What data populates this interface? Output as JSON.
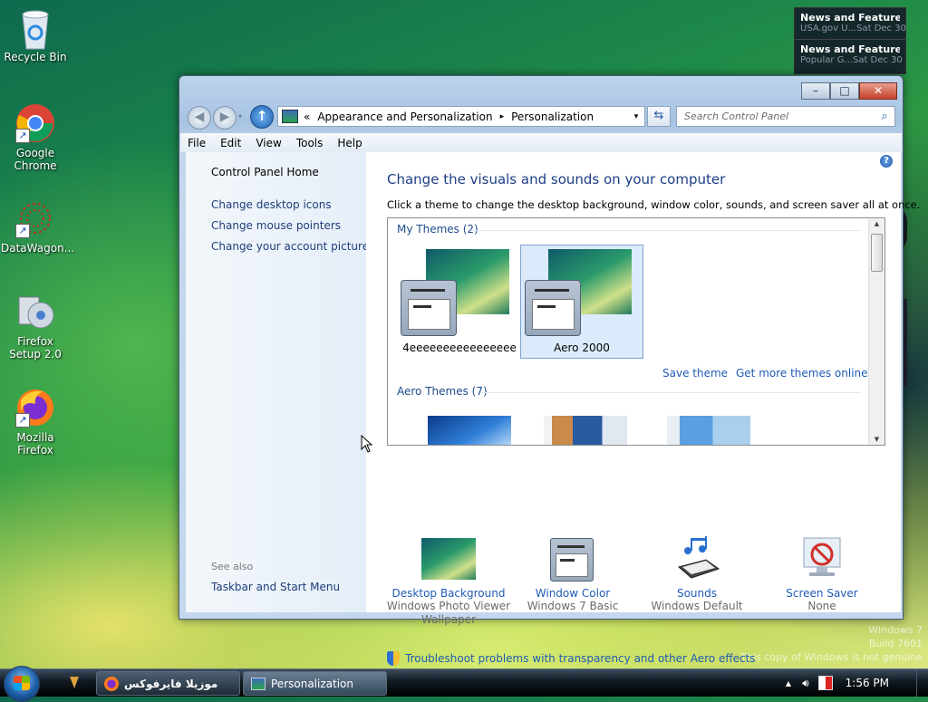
{
  "desktop": {
    "icons": [
      {
        "label": "Recycle Bin",
        "icon": "recycle-bin-icon"
      },
      {
        "label": "Google Chrome",
        "icon": "chrome-icon"
      },
      {
        "label": "DataWagon...",
        "icon": "datawagon-icon"
      },
      {
        "label": "Firefox Setup 2.0",
        "icon": "installer-icon"
      },
      {
        "label": "Mozilla Firefox",
        "icon": "firefox-icon"
      }
    ],
    "gadget": [
      {
        "title": "News and Features f...",
        "source": "USA.gov U...",
        "date": "Sat Dec 30"
      },
      {
        "title": "News and Feature...",
        "source": "Popular G...",
        "date": "Sat Dec 30"
      }
    ],
    "watermark": [
      "Windows 7",
      "Build 7601",
      "This copy of Windows is not genuine"
    ]
  },
  "window": {
    "caption_buttons": {
      "minimize": "–",
      "maximize": "□",
      "close": "✕"
    },
    "address": {
      "chevron": "«",
      "crumbs": [
        "Appearance and Personalization",
        "Personalization"
      ],
      "separator": "▸",
      "dropdown": "▾"
    },
    "search_placeholder": "Search Control Panel",
    "menu": [
      "File",
      "Edit",
      "View",
      "Tools",
      "Help"
    ],
    "left_pane": {
      "home": "Control Panel Home",
      "links": [
        "Change desktop icons",
        "Change mouse pointers",
        "Change your account picture"
      ],
      "see_also": "See also",
      "see_also_links": [
        "Taskbar and Start Menu"
      ]
    },
    "content": {
      "heading": "Change the visuals and sounds on your computer",
      "subheading": "Click a theme to change the desktop background, window color, sounds, and screen saver all at once.",
      "my_themes_header": "My Themes (2)",
      "my_themes": [
        {
          "name": "4eeeeeeeeeeeeeeee",
          "selected": false
        },
        {
          "name": "Aero 2000",
          "selected": true
        }
      ],
      "save_theme": "Save theme",
      "get_more": "Get more themes online",
      "aero_themes_header": "Aero Themes (7)",
      "bottom_items": [
        {
          "title": "Desktop Background",
          "subtitle": "Windows Photo Viewer",
          "subtitle2": "Wallpaper",
          "icon": "desktop-background-icon"
        },
        {
          "title": "Window Color",
          "subtitle": "Windows 7 Basic",
          "subtitle2": "",
          "icon": "window-color-icon"
        },
        {
          "title": "Sounds",
          "subtitle": "Windows Default",
          "subtitle2": "",
          "icon": "sounds-icon"
        },
        {
          "title": "Screen Saver",
          "subtitle": "None",
          "subtitle2": "",
          "icon": "screen-saver-icon"
        }
      ],
      "troubleshoot": "Troubleshoot problems with transparency and other Aero effects",
      "help": "?"
    }
  },
  "taskbar": {
    "buttons": [
      {
        "label": "موزيلا فايرفوكس",
        "icon": "firefox-icon",
        "active": false
      },
      {
        "label": "Personalization",
        "icon": "control-panel-icon",
        "active": true
      }
    ],
    "tray_show_hidden": "▲",
    "clock": "1:56 PM"
  },
  "colors": {
    "link": "#1f5bb4",
    "heading": "#1d3d85",
    "selected_bg": "#dcebfc"
  }
}
